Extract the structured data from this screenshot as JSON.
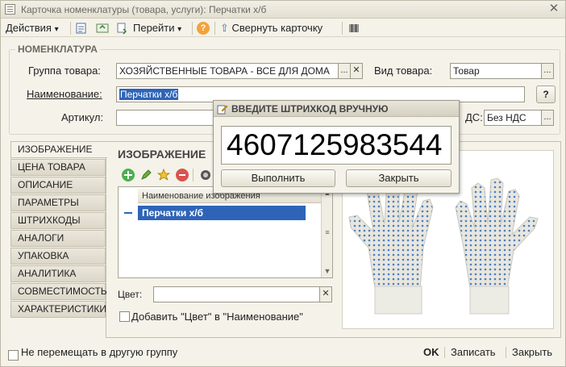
{
  "window": {
    "title": "Карточка номенклатуры (товара, услуги): Перчатки х/б",
    "close_glyph": "✕"
  },
  "toolbar": {
    "actions_label": "Действия",
    "goto_label": "Перейти",
    "collapse_label": "Свернуть карточку",
    "dropdown_glyph": "▾",
    "help_glyph": "?"
  },
  "nomenclature": {
    "group_title": "НОМЕНКЛАТУРА",
    "product_group_label": "Группа товара:",
    "product_group_value": "ХОЗЯЙСТВЕННЫЕ ТОВАРА - ВСЕ ДЛЯ ДОМА",
    "product_kind_label": "Вид товара:",
    "product_kind_value": "Товар",
    "name_label": "Наименование:",
    "name_value": "Перчатки х/б",
    "article_label": "Артикул:",
    "article_value": "",
    "vat_label": "ДС:",
    "vat_value": "Без НДС",
    "select_glyph": "...",
    "clear_glyph": "✕",
    "help_glyph": "?"
  },
  "tabs": [
    {
      "label": "ИЗОБРАЖЕНИЕ",
      "active": true
    },
    {
      "label": "ЦЕНА ТОВАРА",
      "active": false
    },
    {
      "label": "ОПИСАНИЕ",
      "active": false
    },
    {
      "label": "ПАРАМЕТРЫ",
      "active": false
    },
    {
      "label": "ШТРИХКОДЫ",
      "active": false
    },
    {
      "label": "АНАЛОГИ",
      "active": false
    },
    {
      "label": "УПАКОВКА",
      "active": false
    },
    {
      "label": "АНАЛИТИКА",
      "active": false
    },
    {
      "label": "СОВМЕСТИМОСТЬ",
      "active": false
    },
    {
      "label": "ХАРАКТЕРИСТИКИ",
      "active": false
    }
  ],
  "image_section": {
    "title": "ИЗОБРАЖЕНИЕ",
    "grid_header": "Наименование изображения",
    "rows": [
      "Перчатки х/б"
    ],
    "color_label": "Цвет:",
    "color_value": "",
    "add_color_label": "Добавить \"Цвет\" в \"Наименование\"",
    "scroll_up_glyph": "▲",
    "scroll_down_glyph": "▼"
  },
  "barcode_dialog": {
    "title": "ВВЕДИТЕ ШТРИХКОД ВРУЧНУЮ",
    "value": "4607125983544",
    "execute_label": "Выполнить",
    "close_label": "Закрыть"
  },
  "footer": {
    "no_move_label": "Не перемещать в другую группу",
    "ok_label": "OK",
    "save_label": "Записать",
    "close_label": "Закрыть"
  },
  "colors": {
    "accent": "#2e64b8",
    "glove_dots": "#4a7fc1"
  }
}
